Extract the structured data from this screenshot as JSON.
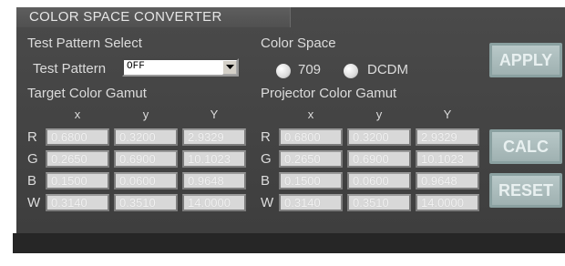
{
  "title": "COLOR SPACE CONVERTER",
  "test_pattern": {
    "section_label": "Test Pattern Select",
    "field_label": "Test Pattern",
    "value": "OFF"
  },
  "color_space": {
    "section_label": "Color Space",
    "options": [
      "709",
      "DCDM"
    ]
  },
  "target_gamut": {
    "label": "Target Color Gamut",
    "headers": [
      "x",
      "y",
      "Y"
    ],
    "rows": [
      {
        "name": "R",
        "values": [
          "0.6800",
          "0.3200",
          "2.9329"
        ]
      },
      {
        "name": "G",
        "values": [
          "0.2650",
          "0.6900",
          "10.1023"
        ]
      },
      {
        "name": "B",
        "values": [
          "0.1500",
          "0.0600",
          "0.9648"
        ]
      },
      {
        "name": "W",
        "values": [
          "0.3140",
          "0.3510",
          "14.0000"
        ]
      }
    ]
  },
  "projector_gamut": {
    "label": "Projector Color Gamut",
    "headers": [
      "x",
      "y",
      "Y"
    ],
    "rows": [
      {
        "name": "R",
        "values": [
          "0.6800",
          "0.3200",
          "2.9329"
        ]
      },
      {
        "name": "G",
        "values": [
          "0.2650",
          "0.6900",
          "10.1023"
        ]
      },
      {
        "name": "B",
        "values": [
          "0.1500",
          "0.0600",
          "0.9648"
        ]
      },
      {
        "name": "W",
        "values": [
          "0.3140",
          "0.3510",
          "14.0000"
        ]
      }
    ]
  },
  "buttons": {
    "apply": "APPLY",
    "calc": "CALC",
    "reset": "RESET"
  }
}
